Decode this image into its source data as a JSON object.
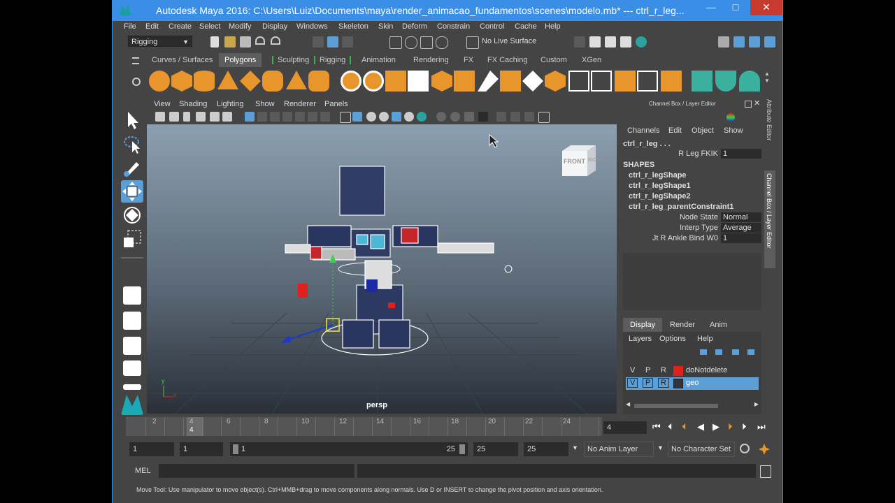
{
  "window": {
    "title": "Autodesk Maya 2016: C:\\Users\\Luiz\\Documents\\maya\\render_animacao_fundamentos\\scenes\\modelo.mb*   ---   ctrl_r_leg...",
    "minimize": "—",
    "maximize": "□",
    "close": "✕"
  },
  "menubar": [
    "File",
    "Edit",
    "Create",
    "Select",
    "Modify",
    "Display",
    "Windows",
    "Skeleton",
    "Skin",
    "Deform",
    "Constrain",
    "Control",
    "Cache",
    "Help"
  ],
  "statusline": {
    "mode": "Rigging",
    "live_surface": "No Live Surface"
  },
  "shelf_tabs": [
    "Curves / Surfaces",
    "Polygons",
    "Sculpting",
    "Rigging",
    "Animation",
    "Rendering",
    "FX",
    "FX Caching",
    "Custom",
    "XGen"
  ],
  "shelf_active_tab": "Polygons",
  "viewport": {
    "menu": [
      "View",
      "Shading",
      "Lighting",
      "Show",
      "Renderer",
      "Panels"
    ],
    "camera_label": "persp",
    "viewcube_front": "FRONT",
    "viewcube_right": "RIGHT",
    "axis_x": "x",
    "axis_y": "y"
  },
  "channel_box": {
    "title": "Channel Box / Layer Editor",
    "menu": [
      "Channels",
      "Edit",
      "Object",
      "Show"
    ],
    "object_name": "ctrl_r_leg . . .",
    "attr_label": "R Leg FKIK",
    "attr_value": "1",
    "shapes_header": "SHAPES",
    "shapes": [
      "ctrl_r_legShape",
      "ctrl_r_legShape1",
      "ctrl_r_legShape2",
      "ctrl_r_leg_parentConstraint1"
    ],
    "constraint_attrs": [
      {
        "label": "Node State",
        "value": "Normal"
      },
      {
        "label": "Interp Type",
        "value": "Average"
      },
      {
        "label": "Jt R Ankle Bind W0",
        "value": "1"
      }
    ]
  },
  "layer_editor": {
    "tabs": [
      "Display",
      "Render",
      "Anim"
    ],
    "active_tab": "Display",
    "menu": [
      "Layers",
      "Options",
      "Help"
    ],
    "layers": [
      {
        "v": "V",
        "p": "P",
        "r": "R",
        "name": "doNotdelete",
        "color": "#e0201c"
      },
      {
        "v": "V",
        "p": "P",
        "r": "R",
        "name": "geo",
        "color": "#333333"
      }
    ]
  },
  "side_tabs": {
    "attribute_editor": "Attribute Editor",
    "channel_box": "Channel Box / Layer Editor"
  },
  "timeline": {
    "ticks": [
      "2",
      "4",
      "6",
      "8",
      "10",
      "12",
      "14",
      "16",
      "18",
      "20",
      "22",
      "24"
    ],
    "current_frame_marker": "4",
    "current_frame_field": "4"
  },
  "range": {
    "start": "1",
    "playback_start": "1",
    "slider_start": "1",
    "slider_end": "25",
    "playback_end": "25",
    "end": "25",
    "anim_layer": "No Anim Layer",
    "character_set": "No Character Set"
  },
  "command_line": {
    "label": "MEL"
  },
  "help_line": "Move Tool: Use manipulator to move object(s). Ctrl+MMB+drag to move components along normals. Use D or INSERT to change the pivot position and axis orientation.",
  "colors": {
    "title_bar": "#3b8ee6",
    "panel": "#444444",
    "field": "#2b2b2b",
    "active_tab": "#5d5d5d",
    "highlight_row": "#5c9fd6",
    "accent_red": "#e0201c"
  }
}
